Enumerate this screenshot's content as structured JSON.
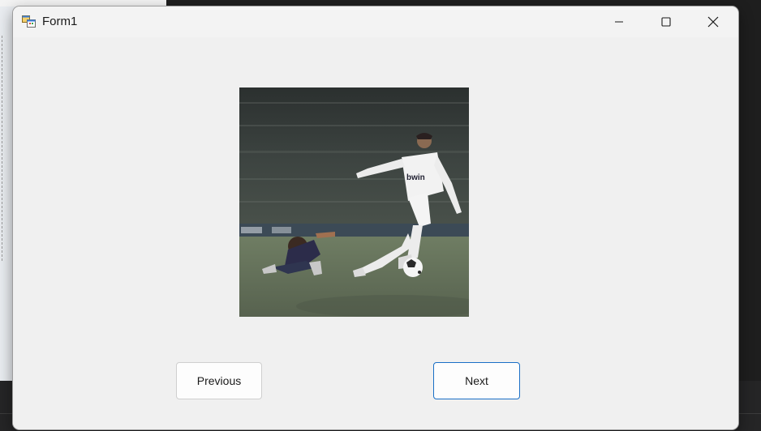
{
  "window": {
    "title": "Form1",
    "app_icon": "winforms-app-icon",
    "controls": {
      "minimize_icon": "minimize-icon",
      "maximize_icon": "maximize-icon",
      "close_icon": "close-icon"
    }
  },
  "picture": {
    "description_icon": "photo-image"
  },
  "buttons": {
    "previous_label": "Previous",
    "next_label": "Next"
  },
  "colors": {
    "form_background": "#f0f0f0",
    "focus_border": "#1a6fc6",
    "button_background": "#fdfdfd"
  }
}
